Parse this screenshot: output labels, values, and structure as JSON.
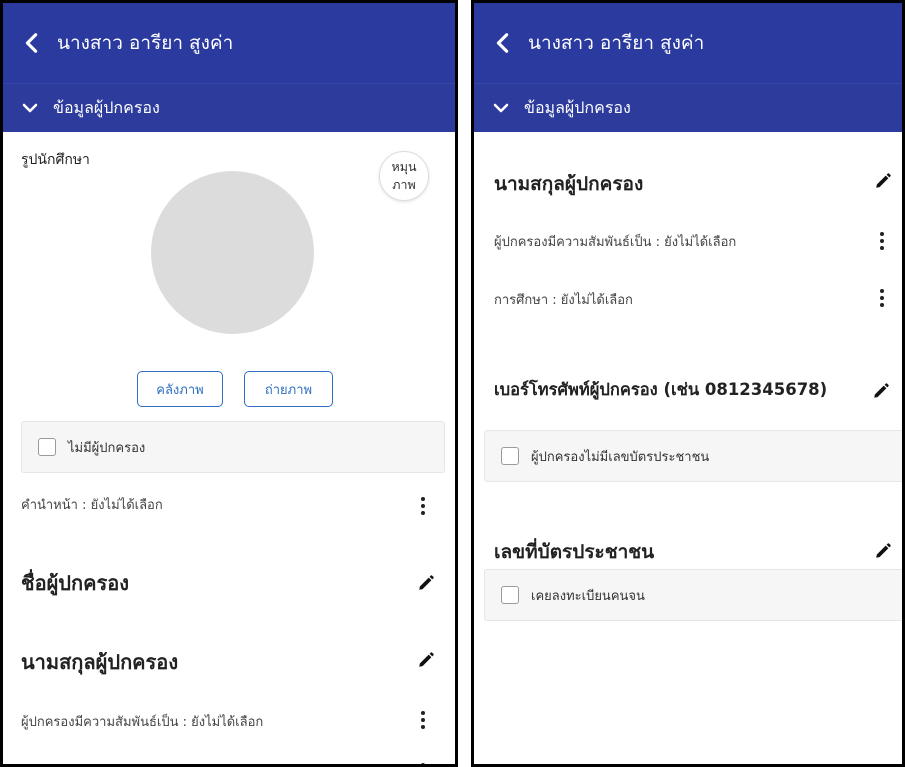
{
  "header": {
    "title": "นางสาว อารียา สูงค่า",
    "section": "ข้อมูลผู้ปกครอง"
  },
  "colors": {
    "appbar": "#2b3a9e",
    "accent_outline": "#2f70c2",
    "avatar_placeholder": "#dcdcdc"
  },
  "left_screen": {
    "photo_label": "รูปนักศึกษา",
    "rotate_label": "หมุน ภาพ",
    "gallery_button": "คลังภาพ",
    "camera_button": "ถ่ายภาพ",
    "no_guardian_checkbox": "ไม่มีผู้ปกครอง",
    "prefix_row": "คำนำหน้า : ยังไม่ได้เลือก",
    "first_name_heading": "ชื่อผู้ปกครอง",
    "last_name_heading": "นามสกุลผู้ปกครอง",
    "relationship_row": "ผู้ปกครองมีความสัมพันธ์เป็น : ยังไม่ได้เลือก"
  },
  "right_screen": {
    "last_name_heading": "นามสกุลผู้ปกครอง",
    "relationship_row": "ผู้ปกครองมีความสัมพันธ์เป็น : ยังไม่ได้เลือก",
    "education_row": "การศึกษา : ยังไม่ได้เลือก",
    "phone_heading": "เบอร์โทรศัพท์ผู้ปกครอง (เช่น 0812345678)",
    "no_id_checkbox": "ผู้ปกครองไม่มีเลขบัตรประชาชน",
    "id_heading": "เลขที่บัตรประชาชน",
    "poor_registered_checkbox": "เคยลงทะเบียนคนจน"
  },
  "icons": [
    "back-arrow-icon",
    "chevron-down-icon",
    "pencil-icon",
    "more-vertical-icon"
  ]
}
